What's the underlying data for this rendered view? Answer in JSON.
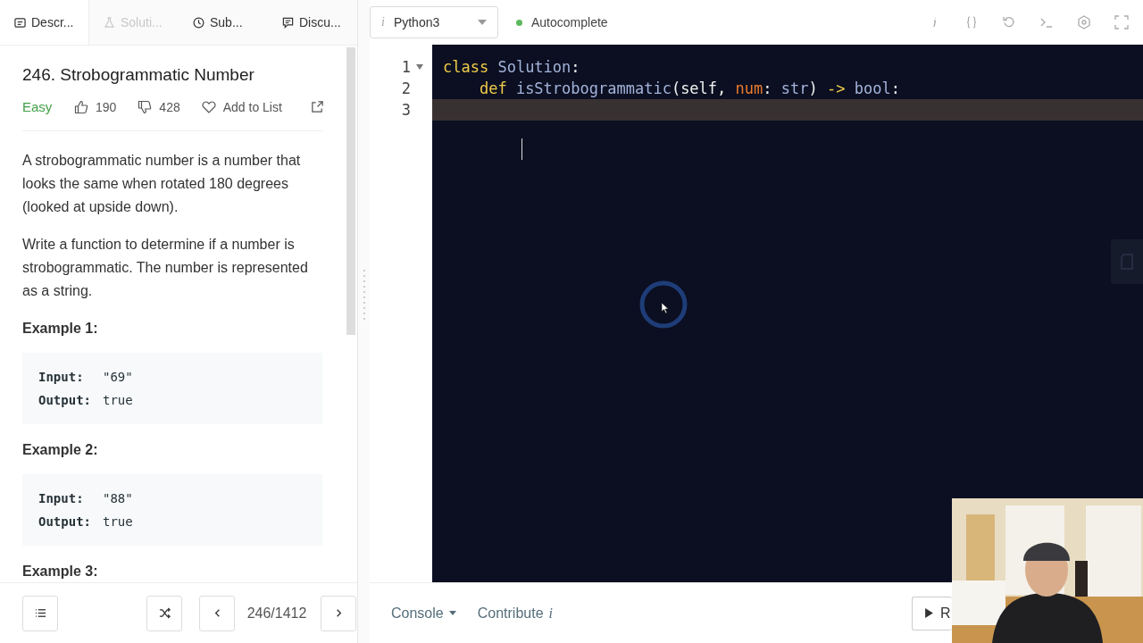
{
  "tabs": [
    {
      "label": "Descr...",
      "selected": true,
      "disabled": false
    },
    {
      "label": "Soluti...",
      "selected": false,
      "disabled": true
    },
    {
      "label": "Sub...",
      "selected": false,
      "disabled": false
    },
    {
      "label": "Discu...",
      "selected": false,
      "disabled": false
    }
  ],
  "problem": {
    "title": "246. Strobogrammatic Number",
    "difficulty": "Easy",
    "likes": "190",
    "dislikes": "428",
    "add_to_list": "Add to List",
    "paragraphs": [
      "A strobogrammatic number is a number that looks the same when rotated 180 degrees (looked at upside down).",
      "Write a function to determine if a number is strobogrammatic. The number is represented as a string."
    ],
    "examples": [
      {
        "heading": "Example 1:",
        "lines": [
          {
            "label": "Input:",
            "value": "\"69\""
          },
          {
            "label": "Output:",
            "value": "true"
          }
        ]
      },
      {
        "heading": "Example 2:",
        "lines": [
          {
            "label": "Input:",
            "value": "\"88\""
          },
          {
            "label": "Output:",
            "value": "true"
          }
        ]
      },
      {
        "heading": "Example 3:"
      }
    ]
  },
  "toolbar": {
    "language_mark": "i",
    "language": "Python3",
    "autocomplete": "Autocomplete",
    "autocomplete_on": true
  },
  "editor": {
    "lines": [
      {
        "number": "1",
        "foldable": true,
        "current": false,
        "tokens": [
          {
            "kind": "keyword",
            "text": "class",
            "spaced": false
          },
          {
            "kind": "type",
            "text": "Solution",
            "spaced": true
          },
          {
            "kind": "plain",
            "text": ":",
            "spaced": false
          }
        ],
        "children": [
          {
            "number": "2",
            "foldable": false,
            "current": false,
            "tokens": [
              {
                "kind": "keyword",
                "text": "def",
                "spaced": false
              },
              {
                "kind": "type",
                "text": "isStrobogrammatic",
                "spaced": true
              },
              {
                "kind": "plain",
                "text": "(self,",
                "spaced": false
              },
              {
                "kind": "param",
                "text": "num",
                "spaced": true
              },
              {
                "kind": "plain",
                "text": ":",
                "spaced": false
              },
              {
                "kind": "type",
                "text": "str",
                "spaced": true
              },
              {
                "kind": "plain",
                "text": ")",
                "spaced": false
              },
              {
                "kind": "keyword",
                "text": "->",
                "spaced": true
              },
              {
                "kind": "type",
                "text": "bool",
                "spaced": true
              },
              {
                "kind": "plain",
                "text": ":",
                "spaced": false
              }
            ]
          }
        ]
      },
      {
        "number": "3",
        "foldable": false,
        "current": true
      }
    ]
  },
  "footer": {
    "counter": "246/1412",
    "console": "Console",
    "contribute": "Contribute",
    "contribute_mark": "i",
    "run": "R"
  }
}
